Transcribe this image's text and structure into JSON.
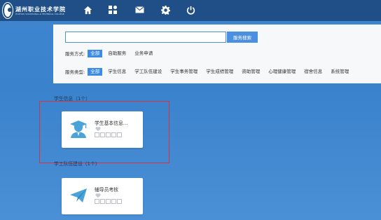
{
  "header": {
    "logo_cn": "湖州职业技术学院",
    "logo_en": "HUZHOU VOCATIONAL & TECHNICAL COLLEGE",
    "nav_icons": [
      "home-icon",
      "apps-icon",
      "mail-icon",
      "settings-icon",
      "power-icon"
    ]
  },
  "search": {
    "placeholder": "",
    "button_label": "服务搜索"
  },
  "service_mode": {
    "label": "服务方式:",
    "options": [
      "全部",
      "自助服务",
      "业务申请"
    ],
    "selected": "全部"
  },
  "service_type": {
    "label": "服务类型:",
    "options": [
      "全部",
      "学生信息",
      "学工队伍建设",
      "学生事务管理",
      "学生成绩管理",
      "资助管理",
      "心理健康管理",
      "宿舍信息",
      "系统管理"
    ],
    "selected": "全部"
  },
  "sections": [
    {
      "title": "学生信息（1个）",
      "cards": [
        {
          "name": "学生基本信息...",
          "icon": "graduate-student-icon"
        }
      ]
    },
    {
      "title": "学工队伍建设（1个）",
      "cards": [
        {
          "name": "辅导员考核",
          "icon": "paper-plane-icon"
        }
      ]
    }
  ],
  "colors": {
    "background": "#3f86cf",
    "topbar": "#1f4f86",
    "accent": "#3c8be6",
    "highlight": "#d9323a",
    "card_icon": "#4aa3d8"
  }
}
